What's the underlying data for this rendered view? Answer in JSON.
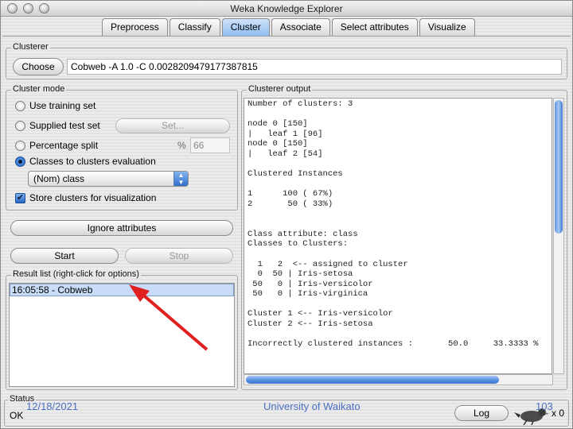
{
  "window": {
    "title": "Weka Knowledge Explorer"
  },
  "tabs": [
    {
      "label": "Preprocess",
      "active": false
    },
    {
      "label": "Classify",
      "active": false
    },
    {
      "label": "Cluster",
      "active": true
    },
    {
      "label": "Associate",
      "active": false
    },
    {
      "label": "Select attributes",
      "active": false
    },
    {
      "label": "Visualize",
      "active": false
    }
  ],
  "clusterer": {
    "group_label": "Clusterer",
    "choose_label": "Choose",
    "config": "Cobweb -A 1.0 -C 0.0028209479177387815"
  },
  "cluster_mode": {
    "group_label": "Cluster mode",
    "options": [
      {
        "label": "Use training set",
        "selected": false
      },
      {
        "label": "Supplied test set",
        "selected": false
      },
      {
        "label": "Percentage split",
        "selected": false
      },
      {
        "label": "Classes to clusters evaluation",
        "selected": true
      }
    ],
    "set_button": "Set...",
    "percent_symbol": "%",
    "percent_value": "66",
    "class_select": "(Nom) class",
    "store_clusters_label": "Store clusters for visualization",
    "store_clusters_checked": true
  },
  "ignore_attributes_label": "Ignore attributes",
  "start_label": "Start",
  "stop_label": "Stop",
  "result_list": {
    "group_label": "Result list (right-click for options)",
    "items": [
      "16:05:58 - Cobweb"
    ]
  },
  "output": {
    "group_label": "Clusterer output",
    "lines": [
      "Number of clusters: 3",
      "",
      "node 0 [150]",
      "|   leaf 1 [96]",
      "node 0 [150]",
      "|   leaf 2 [54]",
      "",
      "Clustered Instances",
      "",
      "1      100 ( 67%)",
      "2       50 ( 33%)",
      "",
      "",
      "Class attribute: class",
      "Classes to Clusters:",
      "",
      "  1   2  <-- assigned to cluster",
      "  0  50 | Iris-setosa",
      " 50   0 | Iris-versicolor",
      " 50   0 | Iris-virginica",
      "",
      "Cluster 1 <-- Iris-versicolor",
      "Cluster 2 <-- Iris-setosa",
      "",
      "Incorrectly clustered instances :       50.0     33.3333 %"
    ]
  },
  "status": {
    "group_label": "Status",
    "text": "OK",
    "log_label": "Log",
    "count": "x 0"
  },
  "footer": {
    "date": "12/18/2021",
    "institution": "University of Waikato",
    "page_number": "103"
  },
  "colors": {
    "tab_active": "#8fbdf0",
    "selection": "#c9dcf7",
    "annotation_arrow": "#e02020",
    "footer_text": "#4a6fc2"
  }
}
